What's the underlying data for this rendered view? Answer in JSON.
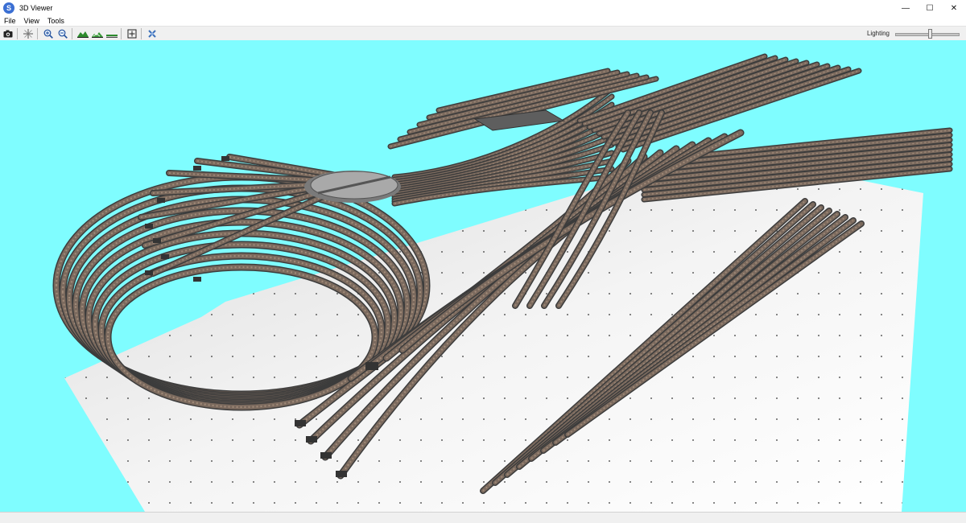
{
  "window": {
    "title": "3D Viewer",
    "app_icon_letter": "S",
    "controls": {
      "minimize": "—",
      "maximize": "☐",
      "close": "✕"
    }
  },
  "menu": {
    "items": [
      "File",
      "View",
      "Tools"
    ]
  },
  "toolbar": {
    "buttons": [
      {
        "name": "camera-icon"
      },
      {
        "name": "crosshair-icon"
      },
      {
        "name": "zoom-in-icon"
      },
      {
        "name": "zoom-out-icon"
      },
      {
        "name": "terrain-icon"
      },
      {
        "name": "terrain-alt-icon"
      },
      {
        "name": "baseboard-icon"
      },
      {
        "name": "fit-view-icon"
      },
      {
        "name": "close-view-icon"
      }
    ],
    "lighting_label": "Lighting",
    "lighting_level": 0.55
  },
  "viewport": {
    "background_color": "#7ffdff",
    "baseboard_color": "#f2f2f2",
    "track_color": "#7b6a5e",
    "rail_color": "#4a4a4a",
    "turntable_color": "#a9a9a9",
    "platform_color": "#5e5e5e"
  }
}
